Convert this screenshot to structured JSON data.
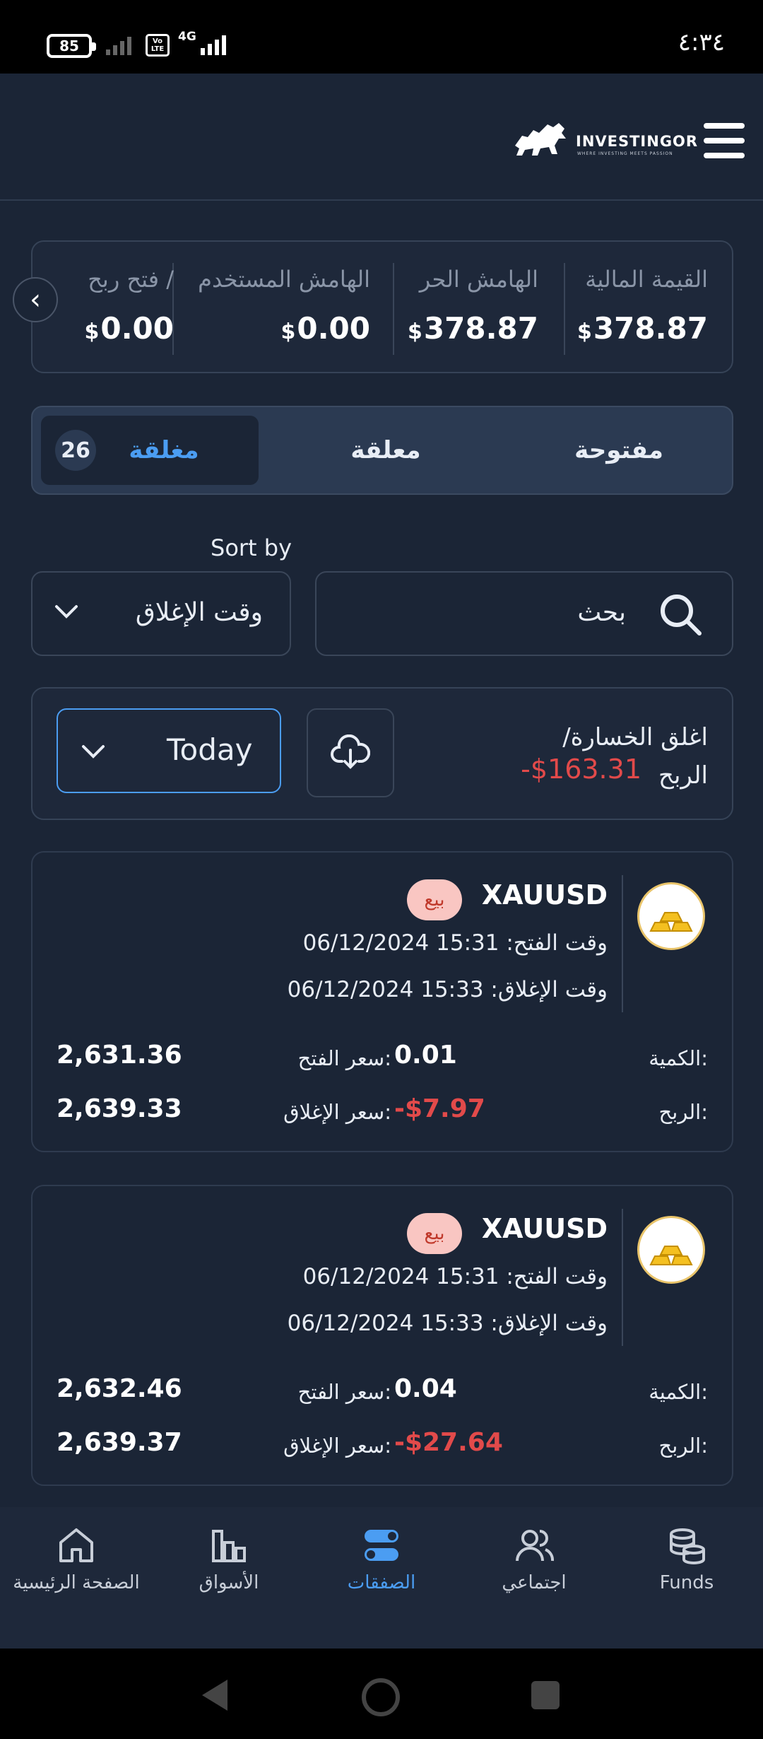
{
  "status_bar": {
    "battery": "85",
    "network": "4G",
    "volte": "Vo LTE",
    "time": "٤:٣٤"
  },
  "header": {
    "brand": "INVESTINGOR",
    "tagline": "WHERE INVESTING MEETS PASSION"
  },
  "summary": {
    "items": [
      {
        "label": "القيمة المالية",
        "currency": "$",
        "value": "378.87"
      },
      {
        "label": "الهامش الحر",
        "currency": "$",
        "value": "378.87"
      },
      {
        "label": "الهامش المستخدم",
        "currency": "$",
        "value": "0.00"
      },
      {
        "label": "فتح ربح /",
        "currency": "$",
        "value": "0.00"
      }
    ]
  },
  "tabs": {
    "open": "مفتوحة",
    "pending": "معلقة",
    "closed": "مغلقة",
    "closed_count": "26"
  },
  "sort": {
    "label": "Sort by",
    "value": "وقت الإغلاق"
  },
  "search": {
    "placeholder": "بحث"
  },
  "pnl": {
    "label": "اغلق الخسارة/ الربح",
    "value": "-$163.31",
    "date_filter": "Today"
  },
  "trades": [
    {
      "symbol": "XAUUSD",
      "side": "بيع",
      "open_time_label": "وقت الفتح:",
      "open_time": "15:31 06/12/2024",
      "close_time_label": "وقت الإغلاق:",
      "close_time": "15:33 06/12/2024",
      "qty_label": "الكمية:",
      "qty": "0.01",
      "open_price_label": "سعر الفتح:",
      "open_price": "2,631.36",
      "profit_label": "الربح:",
      "profit": "-$7.97",
      "close_price_label": "سعر الإغلاق:",
      "close_price": "2,639.33"
    },
    {
      "symbol": "XAUUSD",
      "side": "بيع",
      "open_time_label": "وقت الفتح:",
      "open_time": "15:31 06/12/2024",
      "close_time_label": "وقت الإغلاق:",
      "close_time": "15:33 06/12/2024",
      "qty_label": "الكمية:",
      "qty": "0.04",
      "open_price_label": "سعر الفتح:",
      "open_price": "2,632.46",
      "profit_label": "الربح:",
      "profit": "-$27.64",
      "close_price_label": "سعر الإغلاق:",
      "close_price": "2,639.37"
    }
  ],
  "bottom_nav": [
    {
      "label": "الصفحة الرئيسية",
      "icon": "home-icon"
    },
    {
      "label": "الأسواق",
      "icon": "bar-chart-icon"
    },
    {
      "label": "الصفقات",
      "icon": "trades-toggle-icon",
      "active": true
    },
    {
      "label": "اجتماعي",
      "icon": "users-icon"
    },
    {
      "label": "Funds",
      "icon": "coins-icon"
    }
  ],
  "colors": {
    "background": "#1b2536",
    "accent": "#4b9df2",
    "loss": "#e24a4a",
    "sell_badge": "#f9c6c2"
  }
}
